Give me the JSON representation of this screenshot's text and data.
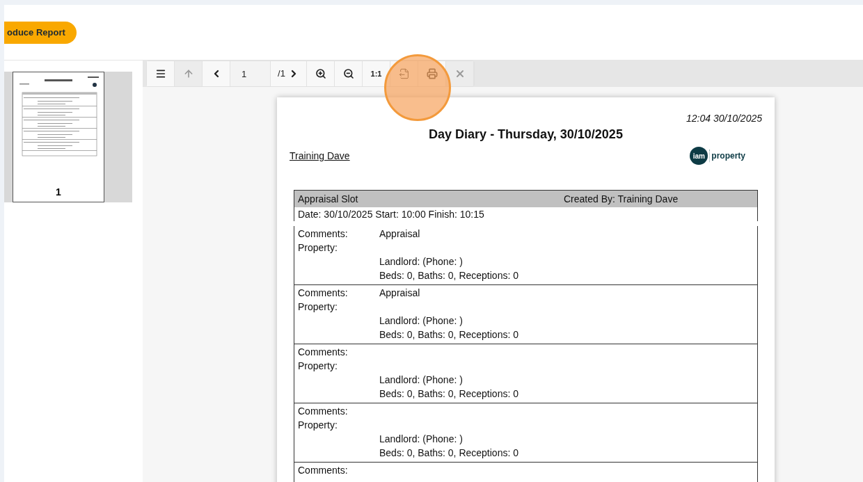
{
  "header": {
    "produce_button": "oduce Report"
  },
  "thumbnails": [
    {
      "page_label": "1",
      "selected": true
    }
  ],
  "toolbar": [
    {
      "kind": "menu",
      "disabled": false
    },
    {
      "kind": "up",
      "disabled": true
    },
    {
      "kind": "prev",
      "disabled": false
    },
    {
      "kind": "page-input",
      "value": "1",
      "disabled": false
    },
    {
      "kind": "next",
      "label": "/1",
      "disabled": false
    },
    {
      "kind": "zoom-in",
      "disabled": false
    },
    {
      "kind": "zoom-out",
      "disabled": false
    },
    {
      "kind": "actual-size",
      "label": "1:1",
      "disabled": false
    },
    {
      "kind": "export",
      "disabled": false
    },
    {
      "kind": "print",
      "disabled": false
    },
    {
      "kind": "close",
      "disabled": true
    }
  ],
  "click_highlight": {
    "on": true
  },
  "report": {
    "timestamp": "12:04 30/10/2025",
    "title": "Day Diary - Thursday, 30/10/2025",
    "user": "Training Dave",
    "logo": {
      "left": "iam",
      "right": "property"
    },
    "slot": {
      "title": "Appraisal Slot",
      "created_by": "Created By: Training Dave",
      "times": "Date: 30/10/2025 Start: 10:00 Finish: 10:15"
    },
    "entries": [
      {
        "comments_label": "Comments:",
        "comments": "Appraisal",
        "property_label": "Property:",
        "landlord": "Landlord: (Phone: )",
        "rooms": "Beds: 0, Baths: 0, Receptions: 0"
      },
      {
        "comments_label": "Comments:",
        "comments": "Appraisal",
        "property_label": "Property:",
        "landlord": "Landlord: (Phone: )",
        "rooms": "Beds: 0, Baths: 0, Receptions: 0"
      },
      {
        "comments_label": "Comments:",
        "property_label": "Property:",
        "landlord": "Landlord: (Phone: )",
        "rooms": "Beds: 0, Baths: 0, Receptions: 0"
      },
      {
        "comments_label": "Comments:",
        "property_label": "Property:",
        "landlord": "Landlord: (Phone: )",
        "rooms": "Beds: 0, Baths: 0, Receptions: 0"
      },
      {
        "comments_label": "Comments:"
      }
    ]
  }
}
